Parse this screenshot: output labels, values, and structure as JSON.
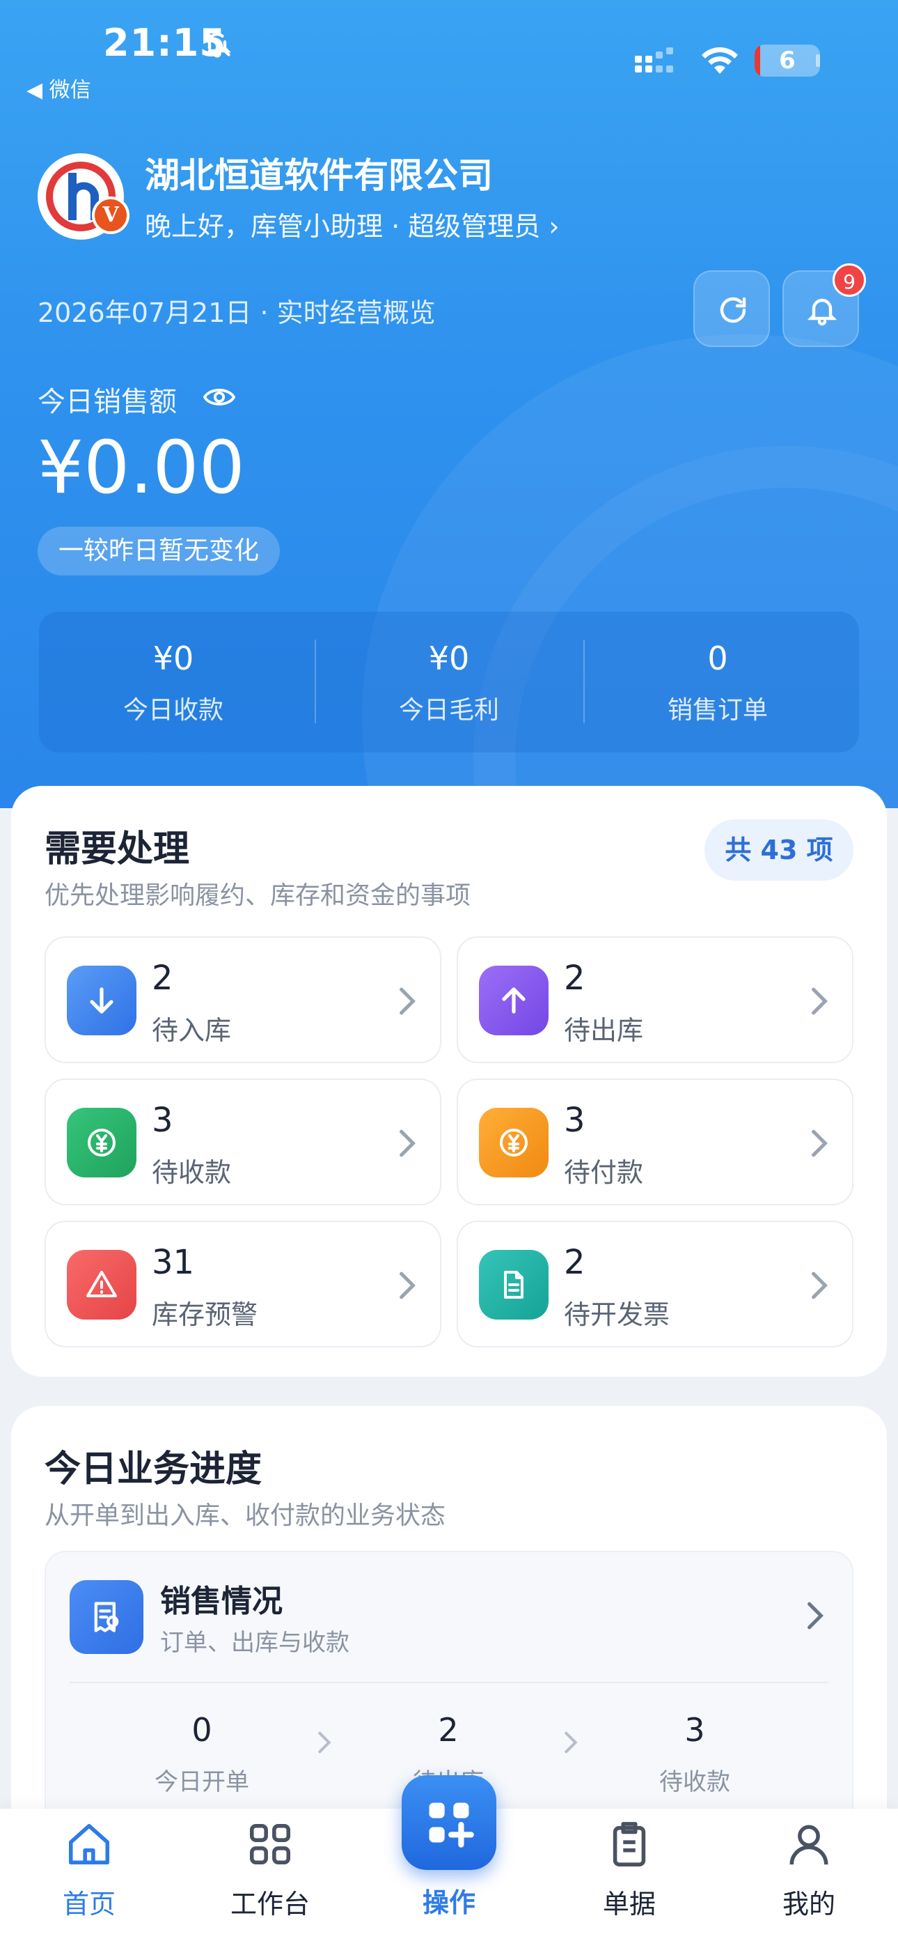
{
  "status_bar": {
    "time": "21:15",
    "back_label": "◀ 微信",
    "battery": "6"
  },
  "header": {
    "company_name": "湖北恒道软件有限公司",
    "greeting": "晚上好，库管小助理 · 超级管理员 ›",
    "date_line": "2026年07月21日 · 实时经营概览",
    "notification_count": "9",
    "logo_badge": "V"
  },
  "sales": {
    "label": "今日销售额",
    "amount": "¥0.00",
    "change": "一较昨日暂无变化",
    "stats": [
      {
        "value": "¥0",
        "label": "今日收款"
      },
      {
        "value": "¥0",
        "label": "今日毛利"
      },
      {
        "value": "0",
        "label": "销售订单"
      }
    ]
  },
  "todo": {
    "title": "需要处理",
    "subtitle": "优先处理影响履约、库存和资金的事项",
    "total": "共 43 项",
    "items": [
      {
        "count": "2",
        "label": "待入库",
        "icon": "arrow-down-icon",
        "color": "#3a86f0"
      },
      {
        "count": "2",
        "label": "待出库",
        "icon": "arrow-up-icon",
        "color": "#8a5cf0"
      },
      {
        "count": "3",
        "label": "待收款",
        "icon": "yuan-icon",
        "color": "#27b36a"
      },
      {
        "count": "3",
        "label": "待付款",
        "icon": "yuan-icon",
        "color": "#f59a1f"
      },
      {
        "count": "31",
        "label": "库存预警",
        "icon": "warning-icon",
        "color": "#ee5050"
      },
      {
        "count": "2",
        "label": "待开发票",
        "icon": "document-icon",
        "color": "#21b5a9"
      }
    ]
  },
  "progress": {
    "title": "今日业务进度",
    "subtitle": "从开单到出入库、收付款的业务状态",
    "sales": {
      "title": "销售情况",
      "subtitle": "订单、出库与收款",
      "stats": [
        {
          "value": "0",
          "label": "今日开单"
        },
        {
          "value": "2",
          "label": "待出库"
        },
        {
          "value": "3",
          "label": "待收款"
        }
      ]
    }
  },
  "tabbar": {
    "tabs": [
      {
        "label": "首页",
        "icon": "home-icon"
      },
      {
        "label": "工作台",
        "icon": "grid-icon"
      },
      {
        "label": "操作",
        "icon": "add-grid-icon"
      },
      {
        "label": "单据",
        "icon": "clipboard-icon"
      },
      {
        "label": "我的",
        "icon": "user-icon"
      }
    ],
    "active_color": "#2d7be8"
  }
}
